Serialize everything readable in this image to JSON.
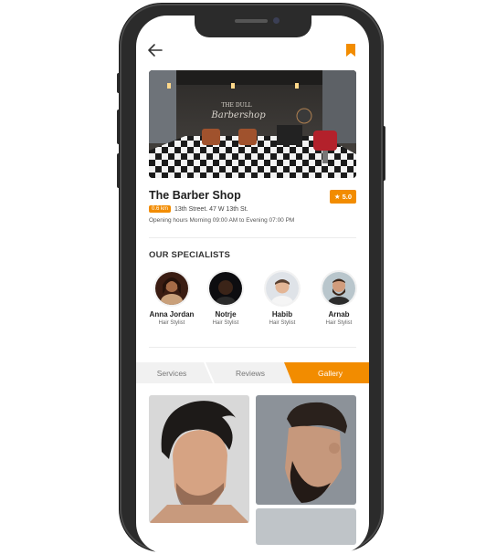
{
  "header": {
    "back_icon": "back-arrow-icon",
    "bookmark_icon": "bookmark-icon"
  },
  "shop": {
    "name": "The Barber Shop",
    "rating": "5.0",
    "distance": "0.6 km",
    "address": "13th Street. 47 W 13th St.",
    "hours": "Opening hours Morning 09:00 AM to Evening 07:00 PM",
    "sign_line1": "THE DULL",
    "sign_line2": "Barbershop"
  },
  "specialists": {
    "title": "OUR SPECIALISTS",
    "items": [
      {
        "name": "Anna Jordan",
        "role": "Hair Stylist"
      },
      {
        "name": "Notrje",
        "role": "Hair Stylist"
      },
      {
        "name": "Habib",
        "role": "Hair Stylist"
      },
      {
        "name": "Arnab",
        "role": "Hair Stylist"
      }
    ]
  },
  "tabs": {
    "items": [
      "Services",
      "Reviews",
      "Gallery"
    ],
    "active": "Gallery"
  },
  "colors": {
    "accent": "#f28c00",
    "text": "#1f1f1f",
    "frame": "#2b2b2b"
  }
}
